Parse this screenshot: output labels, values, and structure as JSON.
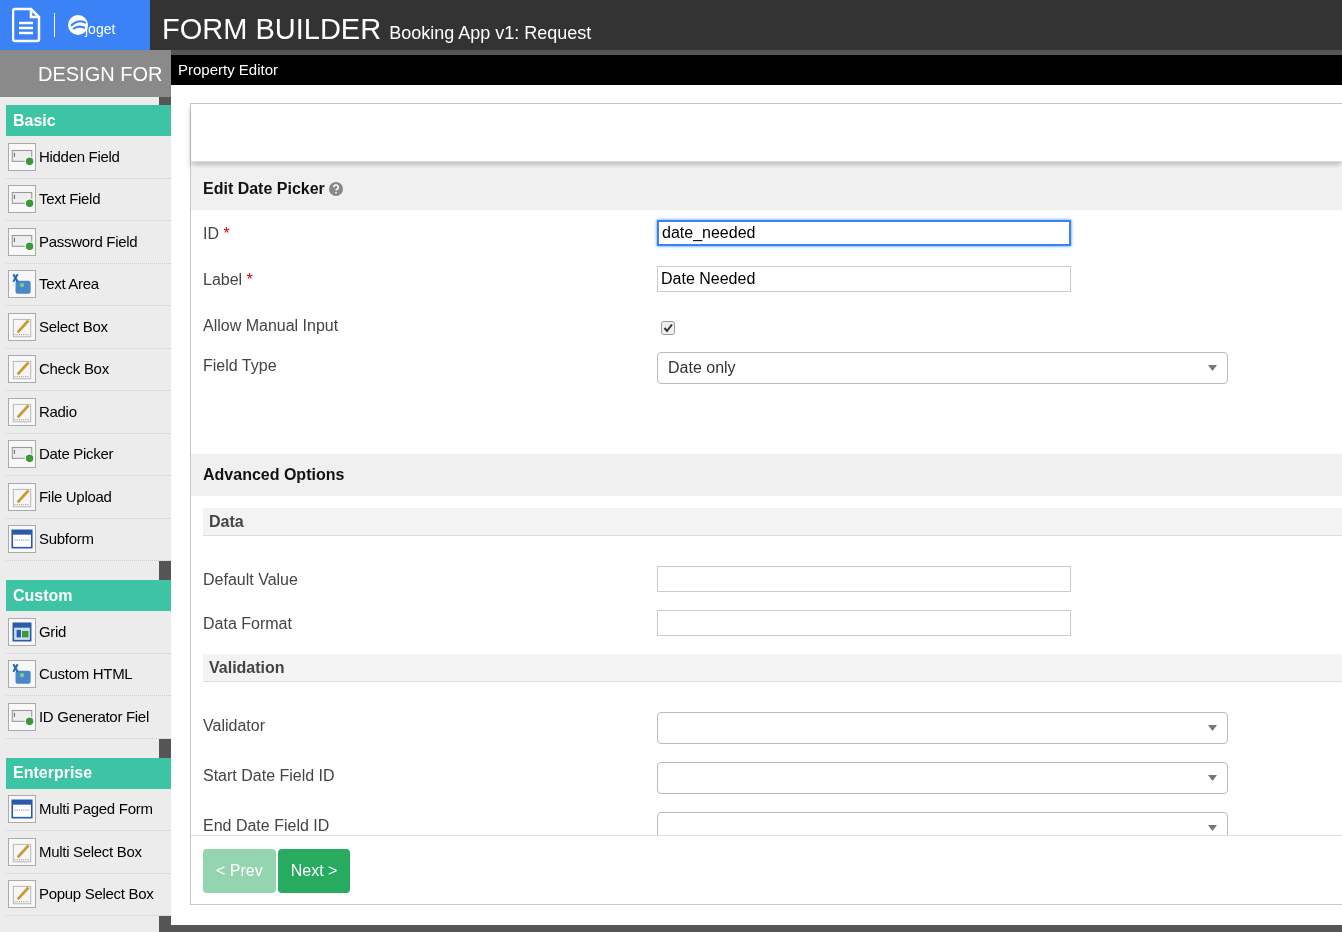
{
  "header": {
    "logo_text": "joget",
    "title": "FORM BUILDER",
    "subtitle": "Booking App v1: Request"
  },
  "design_tab": {
    "label": "DESIGN FOR"
  },
  "palette": [
    {
      "title": "Basic",
      "items": [
        {
          "label": "Hidden Field",
          "kind": "field"
        },
        {
          "label": "Text Field",
          "kind": "field"
        },
        {
          "label": "Password Field",
          "kind": "field"
        },
        {
          "label": "Text Area",
          "kind": "textarea"
        },
        {
          "label": "Select Box",
          "kind": "edit"
        },
        {
          "label": "Check Box",
          "kind": "edit"
        },
        {
          "label": "Radio",
          "kind": "edit"
        },
        {
          "label": "Date Picker",
          "kind": "field"
        },
        {
          "label": "File Upload",
          "kind": "edit"
        },
        {
          "label": "Subform",
          "kind": "subform"
        }
      ]
    },
    {
      "title": "Custom",
      "items": [
        {
          "label": "Grid",
          "kind": "grid"
        },
        {
          "label": "Custom HTML",
          "kind": "textarea"
        },
        {
          "label": "ID Generator Fiel",
          "kind": "field"
        }
      ]
    },
    {
      "title": "Enterprise",
      "items": [
        {
          "label": "Multi Paged Form",
          "kind": "subform"
        },
        {
          "label": "Multi Select Box",
          "kind": "edit"
        },
        {
          "label": "Popup Select Box",
          "kind": "edit"
        }
      ]
    }
  ],
  "property_editor": {
    "title": "Property Editor",
    "section": {
      "title": "Edit Date Picker",
      "fields": [
        {
          "label": "ID",
          "marker": "*",
          "kind": "text",
          "value": "date_needed",
          "focused": true
        },
        {
          "label": "Label",
          "marker": "*",
          "kind": "text",
          "value": "Date Needed",
          "focused": false
        },
        {
          "label": "Allow Manual Input",
          "kind": "checkbox",
          "checked": true
        },
        {
          "label": "Field Type",
          "kind": "select",
          "value": "Date only"
        }
      ]
    },
    "advanced": {
      "title": "Advanced Options",
      "groups": [
        {
          "title": "Data",
          "fields": [
            {
              "label": "Default Value",
              "kind": "text",
              "focused": false
            },
            {
              "label": "Data Format",
              "kind": "text",
              "focused": false
            }
          ]
        },
        {
          "title": "Validation",
          "fields": [
            {
              "label": "Validator",
              "kind": "select"
            },
            {
              "label": "Start Date Field ID",
              "kind": "select"
            },
            {
              "label": "End Date Field ID",
              "kind": "select"
            }
          ]
        }
      ]
    },
    "buttons": [
      {
        "label": "< Prev",
        "disabled": true
      },
      {
        "label": "Next >",
        "disabled": false
      }
    ]
  }
}
